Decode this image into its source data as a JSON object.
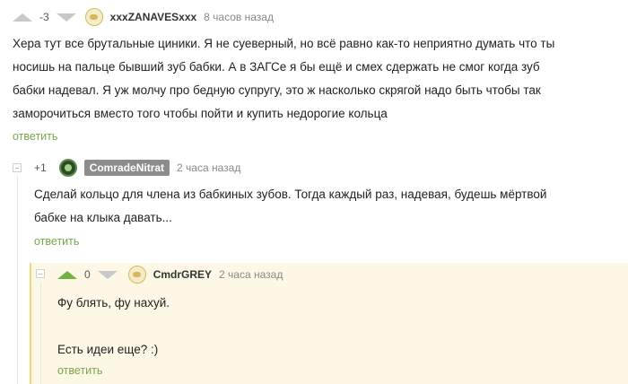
{
  "comments": [
    {
      "rating": "-3",
      "username": "xxxZANAVESxxx",
      "time": "8 часов назад",
      "lines": [
        "Хера тут все брутальные циники. Я не суеверный, но всё равно как-то неприятно думать что ты",
        "носишь на пальце бывший зуб бабки. А в ЗАГСе я бы ещё и смех сдержать не смог когда зуб",
        "бабки надевал. Я уж молчу про бедную супругу, это ж насколько скрягой надо быть чтобы так",
        "заморочиться вместо того чтобы пойти и купить недорогие кольца"
      ],
      "reply_label": "ответить"
    },
    {
      "rating": "+1",
      "username": "ComradeNitrat",
      "time": "2 часа назад",
      "lines": [
        "Сделай кольцо для члена из бабкиных зубов. Тогда каждый раз, надевая, будешь мёртвой",
        "бабке на клыка давать..."
      ],
      "reply_label": "ответить"
    },
    {
      "rating": "0",
      "username": "CmdrGREY",
      "time": "2 часа назад",
      "lines": [
        "Фу блять, фу нахуй.",
        "",
        "Есть идеи еще? :)"
      ],
      "reply_label": "ответить"
    }
  ],
  "colors": {
    "reply_link": "#76a84b",
    "upvote_active": "#72b23f",
    "vote_inactive": "#c8c8c8",
    "highlight_bg": "#fdf8e5",
    "username_badge": "#8c8c8c"
  },
  "icons": [
    "upvote-arrow-icon",
    "downvote-arrow-icon",
    "collapse-icon",
    "avatar-icon"
  ]
}
